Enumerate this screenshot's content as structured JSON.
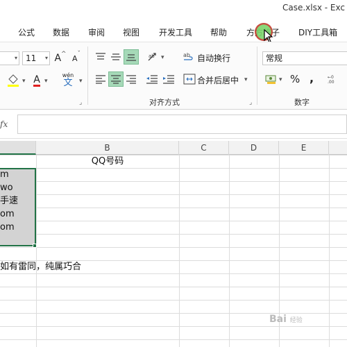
{
  "window": {
    "title": "Case.xlsx  -  Exc"
  },
  "tabs": [
    {
      "label": "公式"
    },
    {
      "label": "数据"
    },
    {
      "label": "审阅"
    },
    {
      "label": "视图"
    },
    {
      "label": "开发工具"
    },
    {
      "label": "帮助"
    },
    {
      "label": "方方格子"
    },
    {
      "label": "DIY工具箱"
    }
  ],
  "ribbon": {
    "font_size": "11",
    "wen_label": "wén",
    "wen_char": "文",
    "alignment": {
      "wrap_text": "自动换行",
      "merge_center": "合并后居中",
      "group_label": "对齐方式"
    },
    "number": {
      "format": "常规",
      "percent": "%",
      "comma": ",",
      "group_label": "数字"
    },
    "font_grow": "A",
    "font_shrink": "A",
    "font_color_letter": "A"
  },
  "formula_bar": {
    "fx": "fx",
    "value": ""
  },
  "columns": [
    {
      "label": ""
    },
    {
      "label": "B"
    },
    {
      "label": "C"
    },
    {
      "label": "D"
    },
    {
      "label": "E"
    }
  ],
  "cells": {
    "b1": "QQ号码",
    "a_values": [
      "m",
      "wo",
      "手速",
      "om",
      "om"
    ],
    "note": "如有雷同，纯属巧合"
  },
  "watermark": {
    "text": "Bai",
    "sub": "经验"
  },
  "colors": {
    "accent": "#217346",
    "highlight": "#a6d9b8",
    "selection": "#d3d3d3"
  }
}
